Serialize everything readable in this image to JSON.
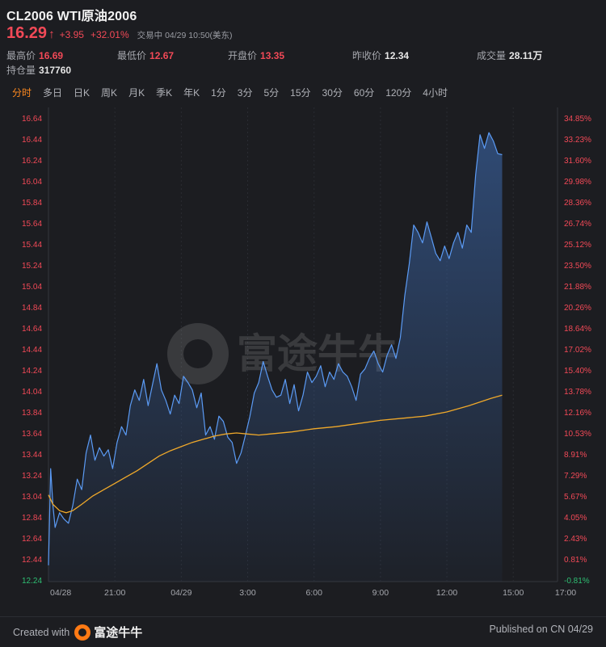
{
  "header": {
    "title": "CL2006 WTI原油2006",
    "price": "16.29",
    "change": "+3.95",
    "change_pct": "+32.01%",
    "status": "交易中 04/29 10:50(美东)"
  },
  "stats": [
    {
      "label": "最高价",
      "value": "16.69",
      "color": "#f24957"
    },
    {
      "label": "最低价",
      "value": "12.67",
      "color": "#f24957"
    },
    {
      "label": "开盘价",
      "value": "13.35",
      "color": "#f24957"
    },
    {
      "label": "昨收价",
      "value": "12.34",
      "color": "#e6e6e6"
    },
    {
      "label": "成交量",
      "value": "28.11万",
      "color": "#e6e6e6"
    },
    {
      "label": "持仓量",
      "value": "317760",
      "color": "#e6e6e6"
    }
  ],
  "tabs": [
    "分时",
    "多日",
    "日K",
    "周K",
    "月K",
    "季K",
    "年K",
    "1分",
    "3分",
    "5分",
    "15分",
    "30分",
    "60分",
    "120分",
    "4小时"
  ],
  "active_tab": "分时",
  "colors": {
    "up": "#f24957",
    "down": "#2fbf73",
    "price_line": "#5b9bf5",
    "avg_line": "#f0a92a",
    "accent": "#ff8a1f"
  },
  "watermark": "富途牛牛",
  "footer": {
    "created_with": "Created with",
    "brand": "富途牛牛",
    "published": "Published on CN 04/29"
  },
  "chart_data": {
    "type": "line",
    "y_left_ticks": [
      "16.64",
      "16.44",
      "16.24",
      "16.04",
      "15.84",
      "15.64",
      "15.44",
      "15.24",
      "15.04",
      "14.84",
      "14.64",
      "14.44",
      "14.24",
      "14.04",
      "13.84",
      "13.64",
      "13.44",
      "13.24",
      "13.04",
      "12.84",
      "12.64",
      "12.44",
      "12.24"
    ],
    "y_right_ticks": [
      "34.85%",
      "33.23%",
      "31.60%",
      "29.98%",
      "28.36%",
      "26.74%",
      "25.12%",
      "23.50%",
      "21.88%",
      "20.26%",
      "18.64%",
      "17.02%",
      "15.40%",
      "13.78%",
      "12.16%",
      "10.53%",
      "8.91%",
      "7.29%",
      "5.67%",
      "4.05%",
      "2.43%",
      "0.81%",
      "-0.81%"
    ],
    "ylim": [
      12.24,
      16.64
    ],
    "x_ticks": [
      "04/28",
      "21:00",
      "04/29",
      "3:00",
      "6:00",
      "9:00",
      "12:00",
      "15:00",
      "17:00"
    ],
    "x_tick_hours": [
      0,
      3,
      6,
      9,
      12,
      15,
      18,
      21,
      23
    ],
    "x_range_hours": [
      0,
      23
    ],
    "series": [
      {
        "kind": "price",
        "x": [
          0,
          0.1,
          0.2,
          0.3,
          0.5,
          0.7,
          0.9,
          1.1,
          1.3,
          1.5,
          1.7,
          1.9,
          2.1,
          2.3,
          2.5,
          2.7,
          2.9,
          3.1,
          3.3,
          3.5,
          3.7,
          3.9,
          4.1,
          4.3,
          4.5,
          4.7,
          4.9,
          5.1,
          5.3,
          5.5,
          5.7,
          5.9,
          6.1,
          6.3,
          6.5,
          6.7,
          6.9,
          7.1,
          7.3,
          7.5,
          7.7,
          7.9,
          8.1,
          8.3,
          8.5,
          8.7,
          8.9,
          9.1,
          9.3,
          9.5,
          9.7,
          9.9,
          10.1,
          10.3,
          10.5,
          10.7,
          10.9,
          11.1,
          11.3,
          11.5,
          11.7,
          11.9,
          12.1,
          12.3,
          12.5,
          12.7,
          12.9,
          13.1,
          13.3,
          13.5,
          13.7,
          13.9,
          14.1,
          14.3,
          14.5,
          14.7,
          14.9,
          15.1,
          15.3,
          15.5,
          15.7,
          15.9,
          16.1,
          16.3,
          16.5,
          16.7,
          16.9,
          17.1,
          17.3,
          17.5,
          17.7,
          17.9,
          18.1,
          18.3,
          18.5,
          18.7,
          18.9,
          19.1,
          19.3,
          19.5,
          19.7,
          19.9,
          20.1,
          20.3,
          20.5
        ],
        "values": [
          12.38,
          13.3,
          12.95,
          12.74,
          12.88,
          12.82,
          12.78,
          12.95,
          13.2,
          13.1,
          13.45,
          13.62,
          13.38,
          13.5,
          13.42,
          13.48,
          13.3,
          13.55,
          13.7,
          13.62,
          13.9,
          14.05,
          13.95,
          14.15,
          13.9,
          14.1,
          14.3,
          14.05,
          13.95,
          13.82,
          14.0,
          13.92,
          14.18,
          14.12,
          14.05,
          13.88,
          14.02,
          13.62,
          13.7,
          13.58,
          13.8,
          13.75,
          13.6,
          13.55,
          13.35,
          13.45,
          13.62,
          13.8,
          14.02,
          14.12,
          14.32,
          14.18,
          14.05,
          13.98,
          14.0,
          14.15,
          13.92,
          14.1,
          13.85,
          14.0,
          14.22,
          14.12,
          14.18,
          14.28,
          14.08,
          14.22,
          14.15,
          14.3,
          14.22,
          14.18,
          14.08,
          13.95,
          14.2,
          14.25,
          14.35,
          14.42,
          14.3,
          14.22,
          14.38,
          14.48,
          14.35,
          14.55,
          14.95,
          15.25,
          15.62,
          15.55,
          15.45,
          15.65,
          15.5,
          15.35,
          15.28,
          15.42,
          15.3,
          15.45,
          15.55,
          15.4,
          15.62,
          15.55,
          16.1,
          16.48,
          16.35,
          16.5,
          16.42,
          16.3,
          16.29
        ]
      },
      {
        "kind": "average",
        "x": [
          0,
          0.2,
          0.5,
          0.8,
          1.1,
          1.5,
          2,
          2.5,
          3,
          3.5,
          4,
          4.5,
          5,
          5.5,
          6,
          6.5,
          7,
          7.5,
          8,
          8.5,
          9,
          9.5,
          10,
          11,
          12,
          13,
          14,
          15,
          16,
          17,
          18,
          19,
          20,
          20.5
        ],
        "values": [
          13.05,
          12.96,
          12.9,
          12.88,
          12.9,
          12.96,
          13.04,
          13.1,
          13.16,
          13.22,
          13.28,
          13.35,
          13.42,
          13.47,
          13.51,
          13.55,
          13.58,
          13.61,
          13.63,
          13.64,
          13.63,
          13.62,
          13.63,
          13.65,
          13.68,
          13.7,
          13.73,
          13.76,
          13.78,
          13.8,
          13.84,
          13.9,
          13.97,
          14.0
        ]
      }
    ],
    "grid": false,
    "legend": "none"
  }
}
